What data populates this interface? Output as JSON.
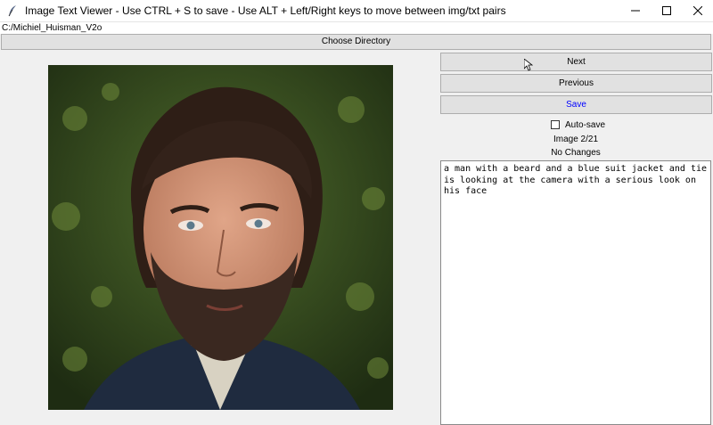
{
  "window": {
    "title": "Image Text Viewer - Use CTRL + S to save - Use ALT + Left/Right keys to move between img/txt pairs",
    "app_icon": "feather-icon",
    "controls": [
      "minimize-icon",
      "maximize-icon",
      "close-icon"
    ]
  },
  "directory": {
    "path": "C:/Michiel_Huisman_V2o",
    "choose_label": "Choose Directory"
  },
  "controls": {
    "next_label": "Next",
    "previous_label": "Previous",
    "save_label": "Save",
    "autosave_label": "Auto-save",
    "autosave_checked": false,
    "image_counter": "Image 2/21",
    "status": "No Changes"
  },
  "caption": {
    "text": "a man with a beard and a blue suit jacket and tie is looking at the camera with a serious look on his face"
  },
  "colors": {
    "save_text": "#0000ff",
    "button_bg": "#e1e1e1",
    "window_bg": "#f0f0f0"
  }
}
